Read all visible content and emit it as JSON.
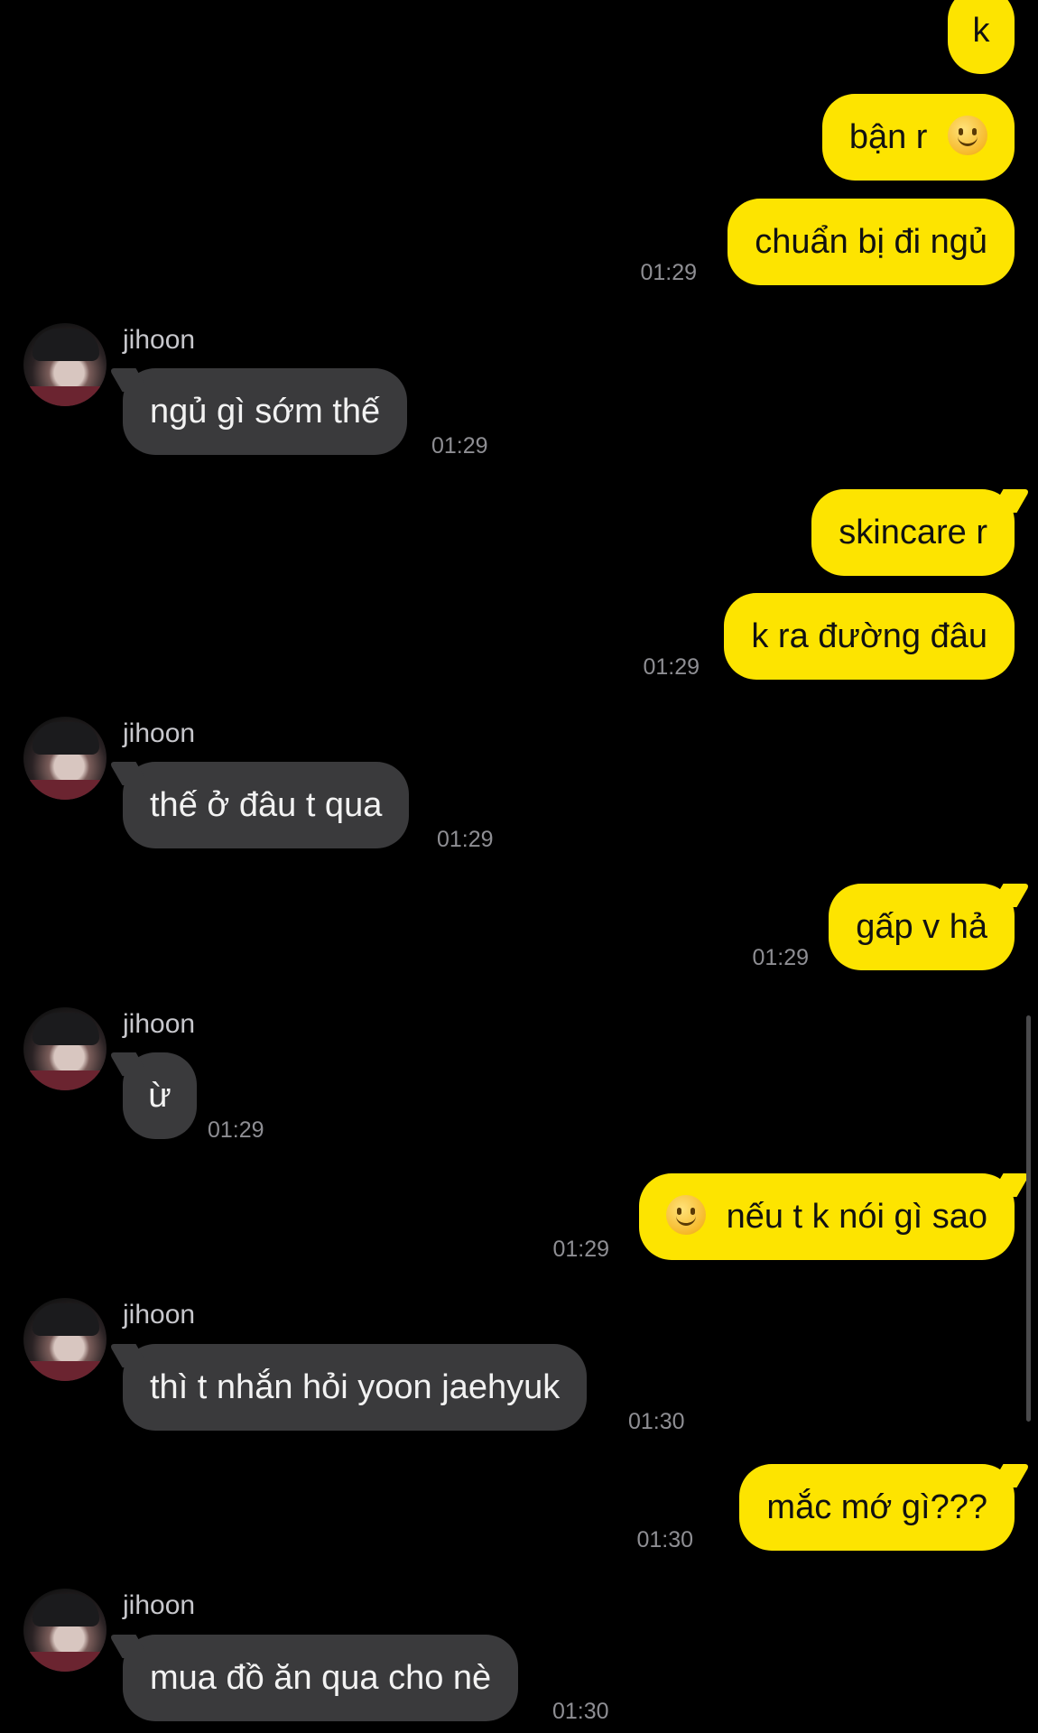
{
  "contact": {
    "name": "jihoon"
  },
  "messages": [
    {
      "id": "m1",
      "side": "out",
      "text": "k",
      "time": ""
    },
    {
      "id": "m2",
      "side": "out",
      "text": "bận r",
      "emoji_after": "slightly-smiling-face",
      "time": ""
    },
    {
      "id": "m3",
      "side": "out",
      "text": "chuẩn bị đi ngủ",
      "time": "01:29"
    },
    {
      "id": "m4",
      "side": "in",
      "sender": "jihoon",
      "text": "ngủ gì sớm thế",
      "time": "01:29"
    },
    {
      "id": "m5",
      "side": "out",
      "text": "skincare r",
      "time": ""
    },
    {
      "id": "m6",
      "side": "out",
      "text": "k ra đường đâu",
      "time": "01:29"
    },
    {
      "id": "m7",
      "side": "in",
      "sender": "jihoon",
      "text": "thế ở đâu t qua",
      "time": "01:29"
    },
    {
      "id": "m8",
      "side": "out",
      "text": "gấp v hả",
      "time": "01:29"
    },
    {
      "id": "m9",
      "side": "in",
      "sender": "jihoon",
      "text": "ừ",
      "time": "01:29"
    },
    {
      "id": "m10",
      "side": "out",
      "text": "nếu t k nói gì sao",
      "emoji_before": "slightly-smiling-face",
      "time": "01:29"
    },
    {
      "id": "m11",
      "side": "in",
      "sender": "jihoon",
      "text": "thì t nhắn hỏi yoon jaehyuk",
      "time": "01:30"
    },
    {
      "id": "m12",
      "side": "out",
      "text": "mắc mớ gì???",
      "time": "01:30"
    },
    {
      "id": "m13",
      "side": "in",
      "sender": "jihoon",
      "text": "mua đồ ăn qua cho nè",
      "time": "01:30"
    }
  ],
  "colors": {
    "background": "#000000",
    "outgoing_bubble": "#fde400",
    "incoming_bubble": "#3a3a3c",
    "timestamp": "#8e8e93"
  }
}
